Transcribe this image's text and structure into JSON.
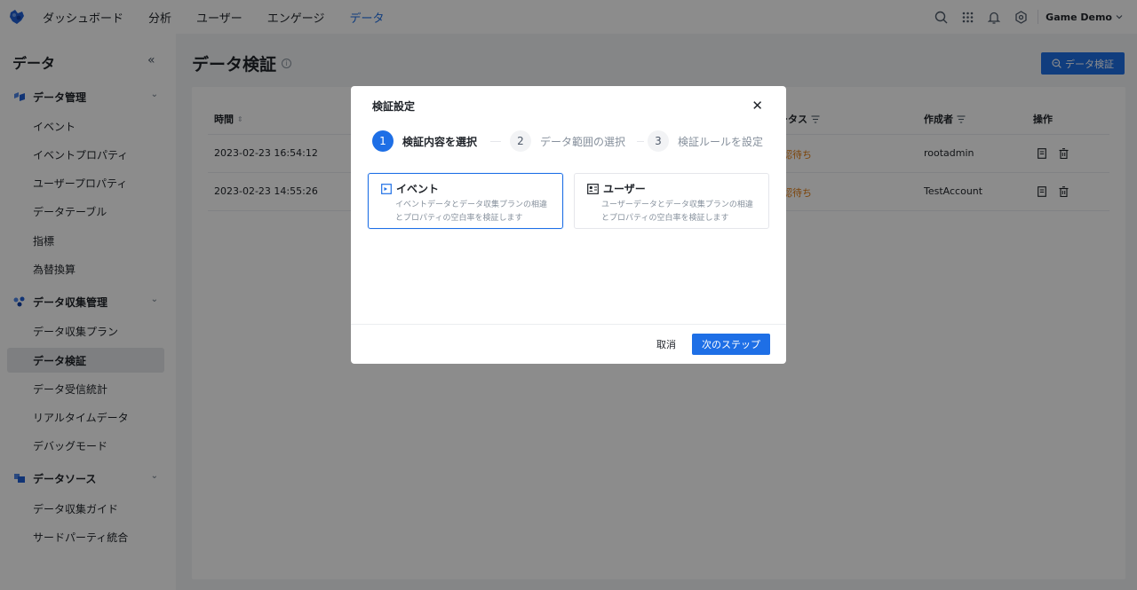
{
  "topnav": {
    "items": [
      {
        "label": "ダッシュボード",
        "active": false
      },
      {
        "label": "分析",
        "active": false
      },
      {
        "label": "ユーザー",
        "active": false
      },
      {
        "label": "エンゲージ",
        "active": false
      },
      {
        "label": "データ",
        "active": true
      }
    ],
    "project_name": "Game Demo",
    "accent_color": "#1e6fe6"
  },
  "sidebar": {
    "title": "データ",
    "groups": [
      {
        "label": "データ管理",
        "icon": "data-management-icon",
        "items": [
          "イベント",
          "イベントプロパティ",
          "ユーザープロパティ",
          "データテーブル",
          "指標",
          "為替換算"
        ]
      },
      {
        "label": "データ収集管理",
        "icon": "collection-management-icon",
        "items": [
          "データ収集プラン",
          "データ検証",
          "データ受信統計",
          "リアルタイムデータ",
          "デバッグモード"
        ]
      },
      {
        "label": "データソース",
        "icon": "data-source-icon",
        "items": [
          "データ収集ガイド",
          "サードパーティ統合"
        ]
      }
    ],
    "active_item": "データ検証"
  },
  "main": {
    "title": "データ検証",
    "primary_button": "データ検証",
    "table": {
      "headers": {
        "time": "時間",
        "status": "ータス",
        "creator": "作成者",
        "actions": "操作"
      },
      "rows": [
        {
          "time": "2023-02-23 16:54:12",
          "status": "認待ち",
          "creator": "rootadmin"
        },
        {
          "time": "2023-02-23 14:55:26",
          "status": "認待ち",
          "creator": "TestAccount"
        }
      ]
    },
    "status_color": "#e27c12"
  },
  "modal": {
    "title": "検証設定",
    "steps": [
      {
        "num": "1",
        "label": "検証内容を選択",
        "active": true
      },
      {
        "num": "2",
        "label": "データ範囲の選択",
        "active": false
      },
      {
        "num": "3",
        "label": "検証ルールを設定",
        "active": false
      }
    ],
    "options": [
      {
        "title": "イベント",
        "desc1": "イベントデータとデータ収集プランの相違",
        "desc2": "とプロパティの空白率を検証します",
        "selected": true
      },
      {
        "title": "ユーザー",
        "desc1": "ユーザーデータとデータ収集プランの相違",
        "desc2": "とプロパティの空白率を検証します",
        "selected": false
      }
    ],
    "cancel_label": "取消",
    "next_label": "次のステップ"
  }
}
